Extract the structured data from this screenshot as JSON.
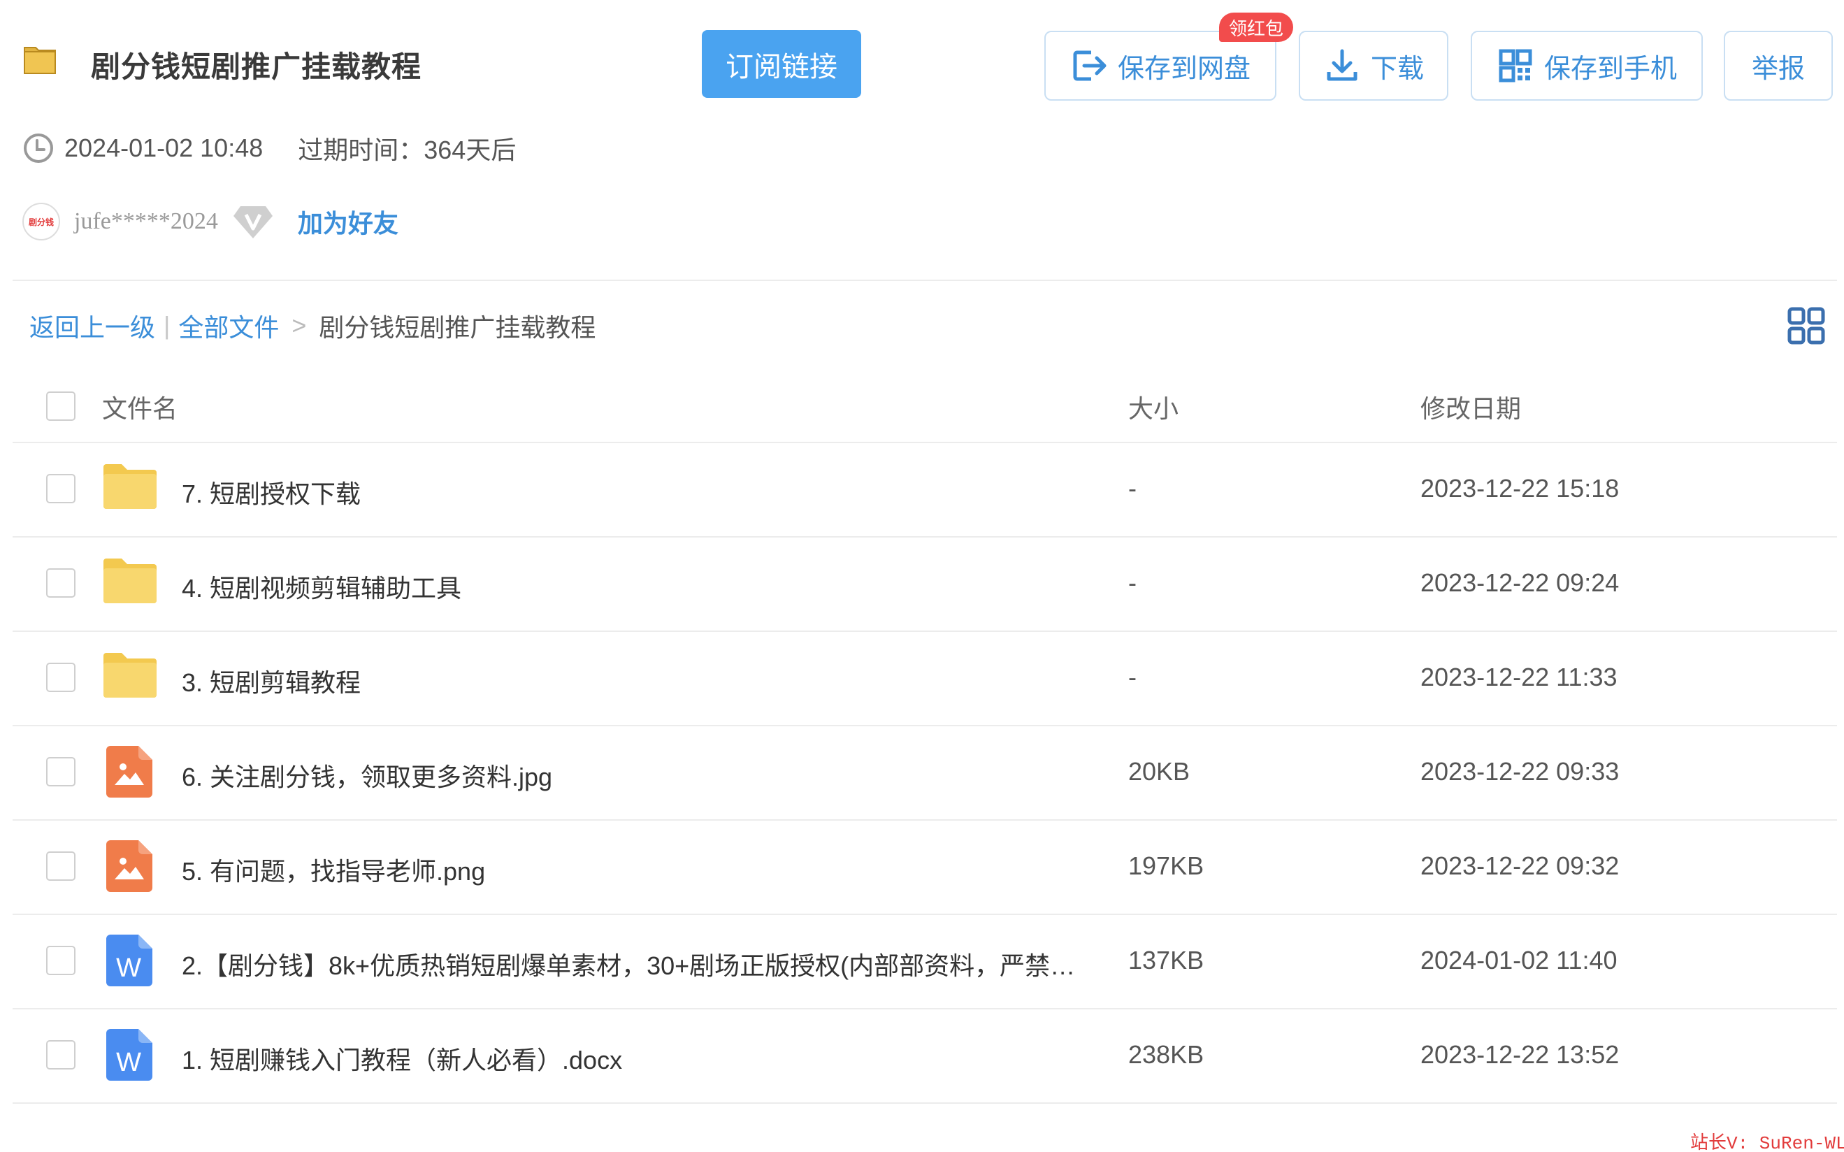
{
  "header": {
    "title": "剧分钱短剧推广挂载教程",
    "subscribe_label": "订阅链接",
    "save_to_disk_label": "保存到网盘",
    "red_badge": "领红包",
    "download_label": "下载",
    "save_to_phone_label": "保存到手机",
    "report_label": "举报"
  },
  "meta": {
    "datetime": "2024-01-02 10:48",
    "expire": "过期时间：364天后"
  },
  "user": {
    "avatar_text": "剧分钱",
    "name": "jufe*****2024",
    "add_friend_label": "加为好友"
  },
  "breadcrumb": {
    "back_label": "返回上一级",
    "all_files_label": "全部文件",
    "separator": ">",
    "current": "剧分钱短剧推广挂载教程"
  },
  "table": {
    "headers": {
      "name": "文件名",
      "size": "大小",
      "date": "修改日期"
    },
    "rows": [
      {
        "type": "folder",
        "name": "7. 短剧授权下载",
        "size": "-",
        "date": "2023-12-22 15:18"
      },
      {
        "type": "folder",
        "name": "4. 短剧视频剪辑辅助工具",
        "size": "-",
        "date": "2023-12-22 09:24"
      },
      {
        "type": "folder",
        "name": "3. 短剧剪辑教程",
        "size": "-",
        "date": "2023-12-22 11:33"
      },
      {
        "type": "image",
        "name": "6. 关注剧分钱，领取更多资料.jpg",
        "size": "20KB",
        "date": "2023-12-22 09:33"
      },
      {
        "type": "image",
        "name": "5. 有问题，找指导老师.png",
        "size": "197KB",
        "date": "2023-12-22 09:32"
      },
      {
        "type": "word",
        "name": "2.【剧分钱】8k+优质热销短剧爆单素材，30+剧场正版授权(内部部资料，严禁…",
        "size": "137KB",
        "date": "2024-01-02 11:40"
      },
      {
        "type": "word",
        "name": "1. 短剧赚钱入门教程（新人必看）.docx",
        "size": "238KB",
        "date": "2023-12-22 13:52"
      }
    ]
  },
  "watermark": "站长V: SuRen-WL",
  "colors": {
    "accent": "#4aa3f0",
    "link": "#3b8ed9",
    "badge": "#f24c4c",
    "folder": "#f8d76e",
    "image_file": "#f07c4a",
    "word_file": "#4a8cf0"
  }
}
